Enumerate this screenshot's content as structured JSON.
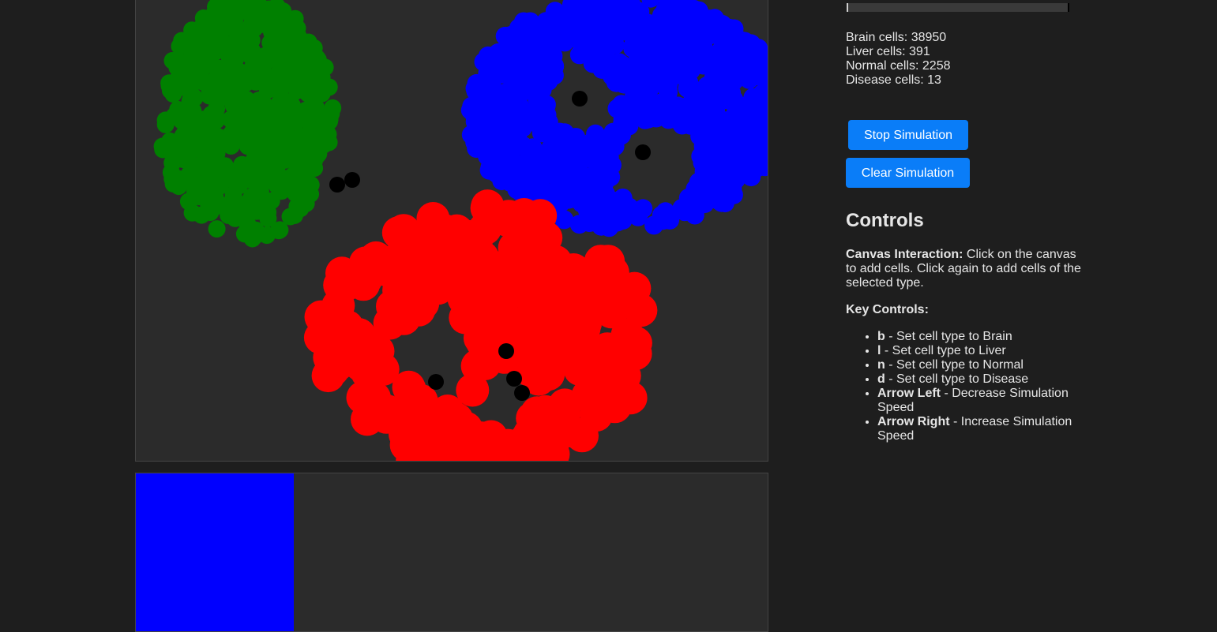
{
  "canvas": {
    "background": "#2b2b2b",
    "clusters": [
      {
        "type": "Normal",
        "color": "#008000"
      },
      {
        "type": "Brain",
        "color": "#0000ff"
      },
      {
        "type": "Liver",
        "color": "#ff0000"
      },
      {
        "type": "Disease",
        "color": "#000000"
      }
    ]
  },
  "selected_type": {
    "name": "Brain",
    "color": "#0000ff"
  },
  "stats": {
    "brain": "Brain cells: 38950",
    "liver": "Liver cells: 391",
    "normal": "Normal cells: 2258",
    "disease": "Disease cells: 13"
  },
  "buttons": {
    "stop": "Stop Simulation",
    "clear": "Clear Simulation"
  },
  "controls": {
    "title": "Controls",
    "canvas_label": "Canvas Interaction:",
    "canvas_text": " Click on the canvas to add cells. Click again to add cells of the selected type.",
    "keys_title": "Key Controls:",
    "keys": [
      {
        "key": "b",
        "desc": " - Set cell type to Brain"
      },
      {
        "key": "l",
        "desc": " - Set cell type to Liver"
      },
      {
        "key": "n",
        "desc": " - Set cell type to Normal"
      },
      {
        "key": "d",
        "desc": " - Set cell type to Disease"
      },
      {
        "key": "Arrow Left",
        "desc": " - Decrease Simulation Speed"
      },
      {
        "key": "Arrow Right",
        "desc": " - Increase Simulation Speed"
      }
    ]
  },
  "colors": {
    "accent": "#0a7df8",
    "page_bg": "#1e1e1e"
  }
}
